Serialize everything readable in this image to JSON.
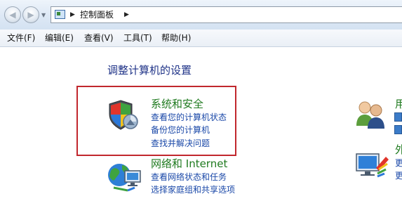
{
  "address_bar": {
    "path": [
      "控制面板"
    ]
  },
  "menu": [
    {
      "label": "文件(F)"
    },
    {
      "label": "编辑(E)"
    },
    {
      "label": "查看(V)"
    },
    {
      "label": "工具(T)"
    },
    {
      "label": "帮助(H)"
    }
  ],
  "main": {
    "title": "调整计算机的设置",
    "categories": [
      {
        "title": "系统和安全",
        "icon": "shield-security-icon",
        "highlighted": true,
        "links": [
          "查看您的计算机状态",
          "备份您的计算机",
          "查找并解决问题"
        ]
      },
      {
        "title": "网络和 Internet",
        "icon": "network-globe-icon",
        "highlighted": false,
        "links": [
          "查看网络状态和任务",
          "选择家庭组和共享选项"
        ]
      },
      {
        "title": "用",
        "icon": "user-accounts-icon",
        "partial": true,
        "links": []
      },
      {
        "title": "外",
        "icon": "appearance-icon",
        "partial": true,
        "links": [
          "更",
          "更"
        ]
      }
    ]
  },
  "colors": {
    "title": "#1e3287",
    "category_title": "#1f7a1f",
    "link": "#1a48a8",
    "highlight_border": "#c1272d"
  }
}
